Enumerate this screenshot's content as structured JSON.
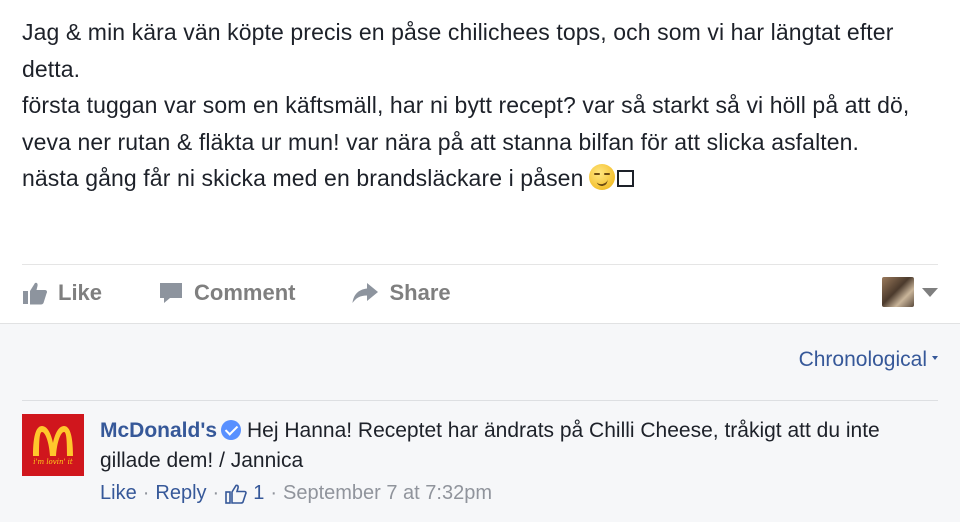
{
  "post": {
    "lines": [
      "Jag & min kära vän köpte precis en påse chilichees tops, och som vi har längtat efter detta.",
      "första tuggan var som en käftsmäll, har ni bytt recept? var så starkt så vi höll på att dö, veva ner rutan & fläkta ur mun! var nära på att stanna bilfan för att slicka asfalten.",
      "nästa gång får ni skicka med en brandsläckare i påsen"
    ],
    "emoji": "smirk-face-icon"
  },
  "actions": {
    "like": "Like",
    "comment": "Comment",
    "share": "Share"
  },
  "comments": {
    "sort_label": "Chronological",
    "items": [
      {
        "author": "McDonald's",
        "avatar_tagline": "i'm lovin' it",
        "text": "Hej Hanna! Receptet har ändrats på Chilli Cheese, tråkigt att du inte gillade dem! / Jannica",
        "like_label": "Like",
        "reply_label": "Reply",
        "like_count": "1",
        "timestamp": "September 7 at 7:32pm",
        "separator": "·"
      }
    ]
  },
  "colors": {
    "text": "#1d2129",
    "link": "#365899",
    "muted": "#7f7f7f",
    "mcdonalds_red": "#d0161d",
    "mcdonalds_yellow": "#ffc72c"
  }
}
